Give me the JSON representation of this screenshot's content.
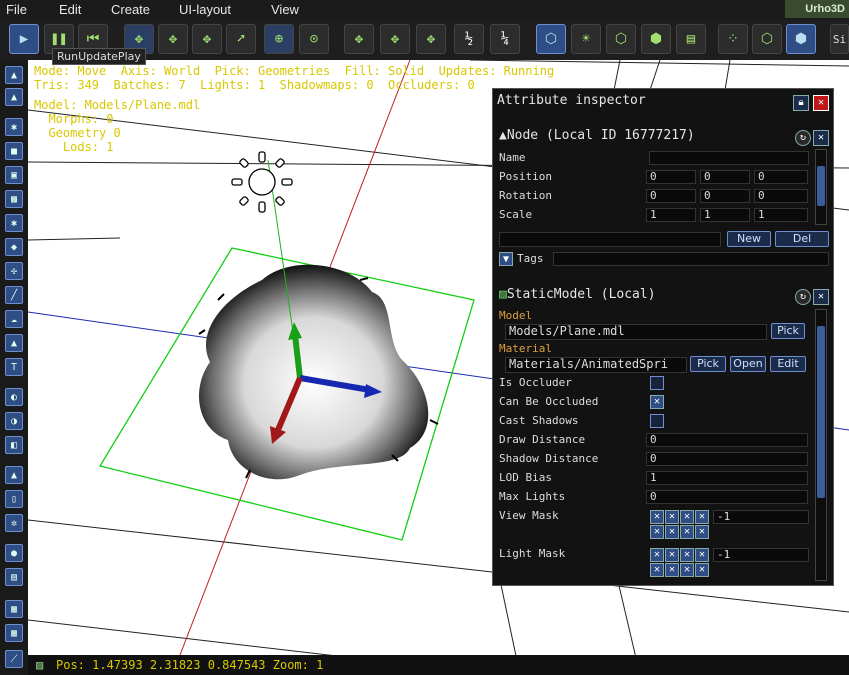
{
  "menu": [
    "File",
    "Edit",
    "Create",
    "UI-layout",
    "View"
  ],
  "logo": "Urho3D",
  "tooltip": "RunUpdatePlay",
  "side_button": "Si",
  "stats": {
    "line1": "Mode: Move  Axis: World  Pick: Geometries  Fill: Solid  Updates: Running",
    "line2": "Tris: 349  Batches: 7  Lights: 1  Shadowmaps: 0  Occluders: 0",
    "line3": "Model: Models/Plane.mdl",
    "line4": "  Morphs: 0",
    "line5": "  Geometry 0",
    "line6": "    Lods: 1"
  },
  "status": "Pos: 1.47393  2.31823  0.847543 Zoom: 1",
  "inspector": {
    "title": "Attribute inspector",
    "node_header": "Node (Local ID 16777217)",
    "name_label": "Name",
    "position_label": "Position",
    "position_values": [
      "0",
      "0",
      "0"
    ],
    "rotation_label": "Rotation",
    "rotation_values": [
      "0",
      "0",
      "0"
    ],
    "scale_label": "Scale",
    "scale_values": [
      "1",
      "1",
      "1"
    ],
    "new_label": "New",
    "del_label": "Del",
    "tags_label": "Tags",
    "component_header": "StaticModel (Local)",
    "model_label": "Model",
    "model_value": "Models/Plane.mdl",
    "pick_label": "Pick",
    "material_label": "Material",
    "material_value": "Materials/AnimatedSpri",
    "open_label": "Open",
    "edit_label": "Edit",
    "is_occluder_label": "Is Occluder",
    "can_be_occluded_label": "Can Be Occluded",
    "cast_shadows_label": "Cast Shadows",
    "draw_distance_label": "Draw Distance",
    "draw_distance_value": "0",
    "shadow_distance_label": "Shadow Distance",
    "shadow_distance_value": "0",
    "lod_bias_label": "LOD Bias",
    "lod_bias_value": "1",
    "max_lights_label": "Max Lights",
    "max_lights_value": "0",
    "view_mask_label": "View Mask",
    "view_mask_value": "-1",
    "light_mask_label": "Light Mask",
    "light_mask_value": "-1"
  }
}
